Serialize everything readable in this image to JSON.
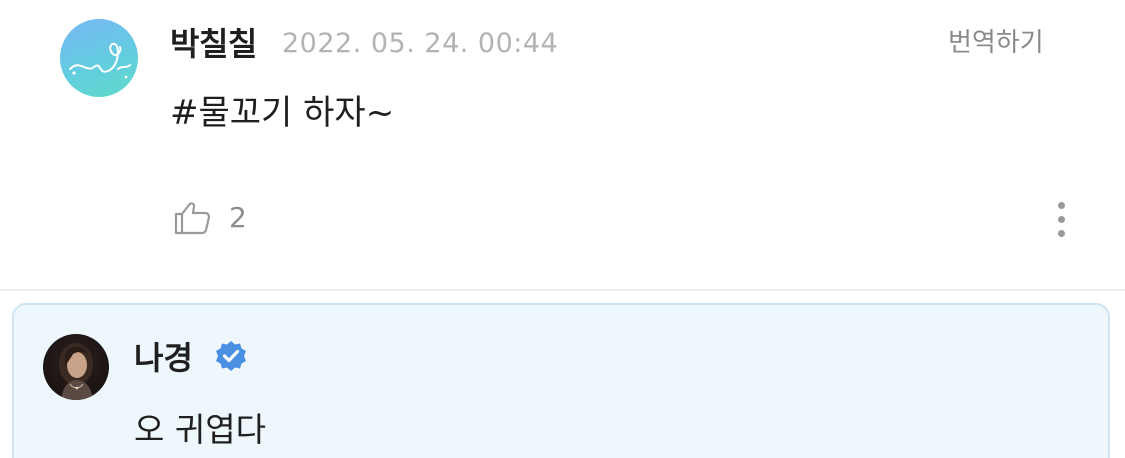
{
  "comment": {
    "author": "박칠칠",
    "timestamp": "2022. 05. 24. 00:44",
    "translate_label": "번역하기",
    "body": "#물꼬기 하자~",
    "like_count": "2",
    "icons": {
      "avatar": "heart-doodle-avatar",
      "like": "thumbs-up-icon",
      "more": "more-vertical-icon"
    }
  },
  "reply": {
    "author": "나경",
    "verified": true,
    "body": "오 귀엽다",
    "icons": {
      "avatar": "profile-photo",
      "badge": "verified-badge-icon"
    }
  },
  "colors": {
    "reply_background": "#eef7fc",
    "reply_border": "#cfe3f1",
    "verified_badge": "#4a90e2",
    "timestamp": "#b3b3b3"
  }
}
